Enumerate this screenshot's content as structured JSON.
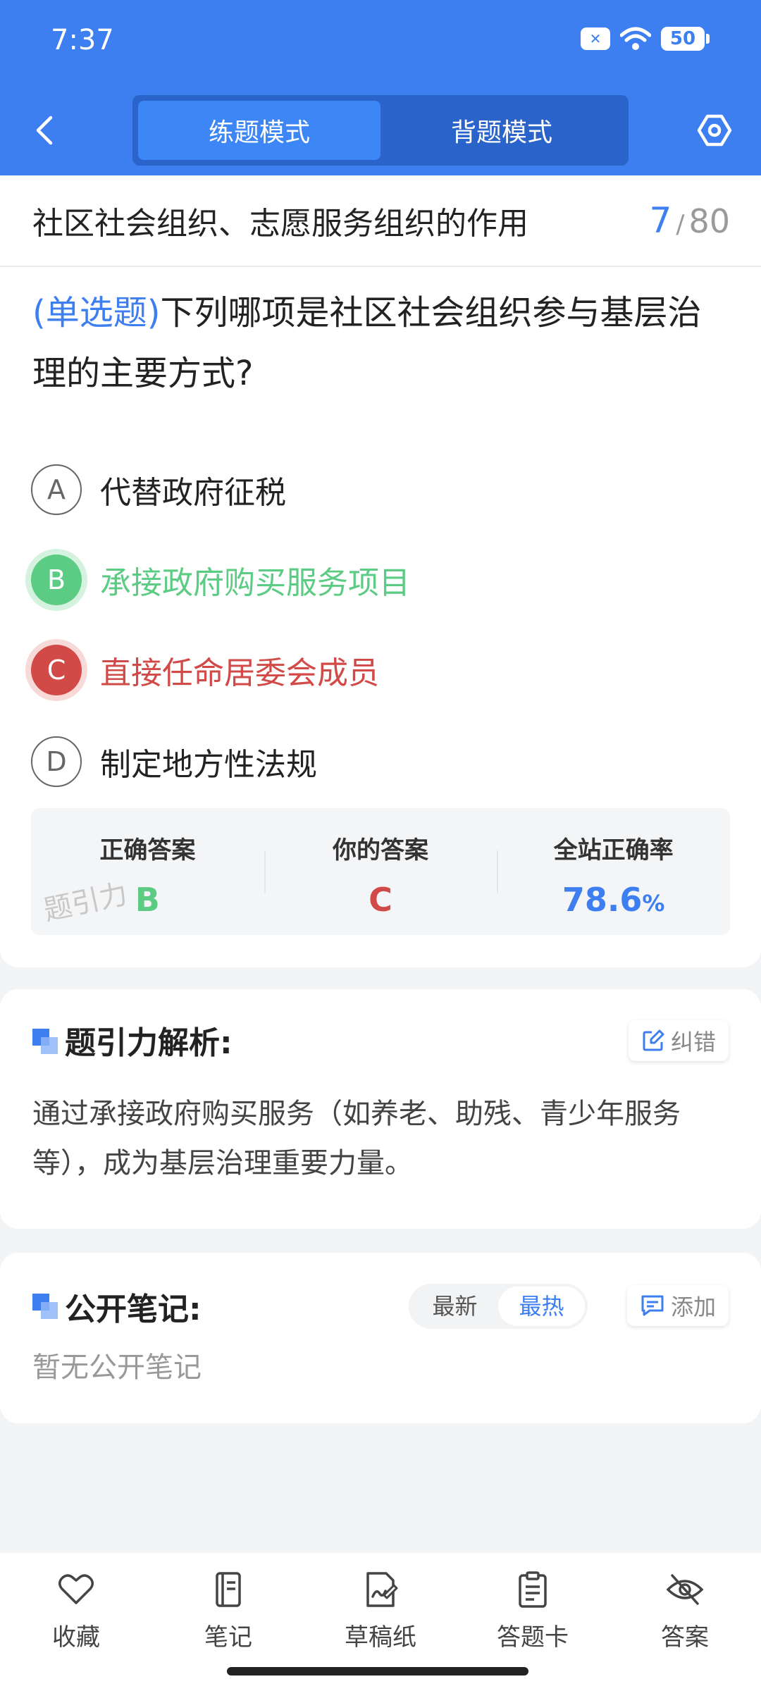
{
  "status_bar": {
    "time": "7:37",
    "battery": "50"
  },
  "header": {
    "tabs": [
      {
        "label": "练题模式",
        "active": true
      },
      {
        "label": "背题模式",
        "active": false
      }
    ]
  },
  "chapter": {
    "title": "社区社会组织、志愿服务组织的作用",
    "current": "7",
    "separator": "/",
    "total": "80"
  },
  "question": {
    "type": "(单选题)",
    "text": "下列哪项是社区社会组织参与基层治理的主要方式?"
  },
  "options": [
    {
      "letter": "A",
      "text": "代替政府征税",
      "state": "normal"
    },
    {
      "letter": "B",
      "text": "承接政府购买服务项目",
      "state": "correct"
    },
    {
      "letter": "C",
      "text": "直接任命居委会成员",
      "state": "wrong"
    },
    {
      "letter": "D",
      "text": "制定地方性法规",
      "state": "normal"
    }
  ],
  "answer_summary": {
    "correct_label": "正确答案",
    "correct_value": "B",
    "yours_label": "你的答案",
    "yours_value": "C",
    "rate_label": "全站正确率",
    "rate_value": "78.6",
    "rate_unit": "%",
    "watermark": "题引力"
  },
  "analysis": {
    "title": "题引力解析:",
    "report_label": "纠错",
    "text": "通过承接政府购买服务（如养老、助残、青少年服务等），成为基层治理重要力量。"
  },
  "notes": {
    "title": "公开笔记:",
    "sort_options": [
      "最新",
      "最热"
    ],
    "sort_active": "最热",
    "add_label": "添加",
    "empty_text": "暂无公开笔记"
  },
  "bottom_nav": [
    {
      "label": "收藏",
      "icon": "heart-icon"
    },
    {
      "label": "笔记",
      "icon": "notebook-icon"
    },
    {
      "label": "草稿纸",
      "icon": "draft-paper-icon"
    },
    {
      "label": "答题卡",
      "icon": "answer-card-icon"
    },
    {
      "label": "答案",
      "icon": "eye-off-icon"
    }
  ],
  "colors": {
    "primary": "#3d7ef0",
    "correct": "#5ccb83",
    "wrong": "#d24a47"
  }
}
